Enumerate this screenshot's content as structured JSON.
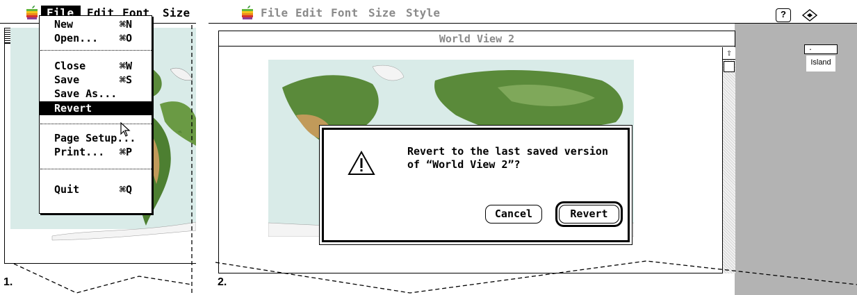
{
  "step1": {
    "label": "1.",
    "menubar": {
      "items": [
        "File",
        "Edit",
        "Font",
        "Size"
      ]
    },
    "file_menu": {
      "items": [
        {
          "label": "New",
          "shortcut": "⌘N"
        },
        {
          "label": "Open...",
          "shortcut": "⌘O"
        },
        {
          "label": "Close",
          "shortcut": "⌘W"
        },
        {
          "label": "Save",
          "shortcut": "⌘S"
        },
        {
          "label": "Save As...",
          "shortcut": ""
        },
        {
          "label": "Revert",
          "shortcut": "",
          "selected": true
        },
        {
          "label": "Page Setup...",
          "shortcut": ""
        },
        {
          "label": "Print...",
          "shortcut": "⌘P"
        },
        {
          "label": "Quit",
          "shortcut": "⌘Q"
        }
      ]
    }
  },
  "step2": {
    "label": "2.",
    "menubar": {
      "items": [
        "File",
        "Edit",
        "Font",
        "Size",
        "Style"
      ]
    },
    "window_title": "World View 2",
    "dialog": {
      "line1": "Revert to the last saved version",
      "line2": "of “World View 2”?",
      "cancel_label": "Cancel",
      "revert_label": "Revert"
    },
    "field_value": ".",
    "field_label": "Island",
    "help_icon_glyph": "?"
  },
  "icons": [
    "apple-icon",
    "warning-icon",
    "help-icon",
    "app-icon",
    "cursor-icon",
    "scroll-up-arrow-icon"
  ],
  "colors": {
    "ocean": "#d9ebe8",
    "land": "#5a8a3a",
    "gray_pane": "#b3b3b3",
    "disabled_text": "#8a8a8a"
  }
}
